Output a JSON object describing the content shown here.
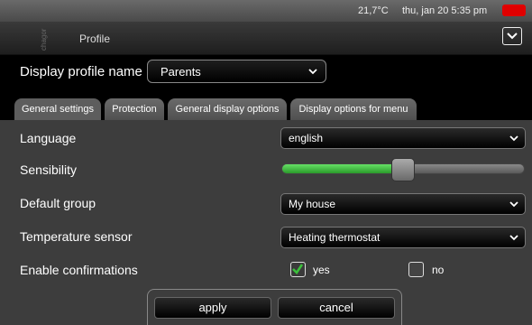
{
  "status": {
    "temperature": "21,7°C",
    "datetime": "thu, jan 20  5:35 pm",
    "alarm_color": "#e00000"
  },
  "header": {
    "logo_text": "chagor",
    "title": "Profile"
  },
  "profile": {
    "label": "Display profile name",
    "value": "Parents"
  },
  "tabs": [
    {
      "label": "General settings"
    },
    {
      "label": "Protection"
    },
    {
      "label": "General display options"
    },
    {
      "label": "Display options for menu"
    }
  ],
  "settings": {
    "language": {
      "label": "Language",
      "value": "english"
    },
    "sensibility": {
      "label": "Sensibility",
      "level_percent": 45
    },
    "default_group": {
      "label": "Default group",
      "value": "My house"
    },
    "temperature_sensor": {
      "label": "Temperature sensor",
      "value": "Heating thermostat"
    },
    "confirmations": {
      "label": "Enable confirmations",
      "yes_label": "yes",
      "no_label": "no",
      "selected": "yes"
    }
  },
  "actions": {
    "apply_label": "apply",
    "cancel_label": "cancel"
  },
  "colors": {
    "accent_green": "#3cc03c",
    "alarm_red": "#e00000"
  }
}
